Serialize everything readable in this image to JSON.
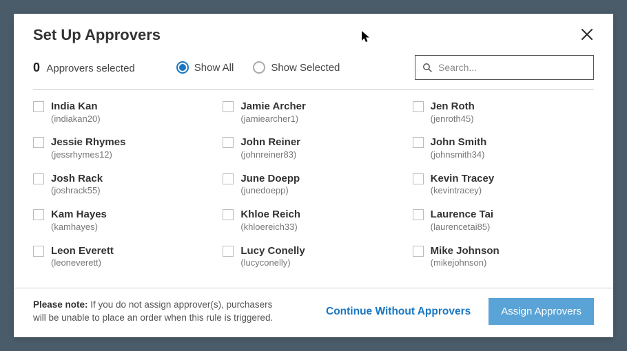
{
  "modal": {
    "title": "Set Up Approvers",
    "selected_count": "0",
    "selected_label": "Approvers selected"
  },
  "filter": {
    "show_all": "Show All",
    "show_selected": "Show Selected",
    "active": "show_all"
  },
  "search": {
    "placeholder": "Search..."
  },
  "approvers": [
    {
      "name": "India Kan",
      "username": "(indiakan20)"
    },
    {
      "name": "Jamie Archer",
      "username": "(jamiearcher1)"
    },
    {
      "name": "Jen Roth",
      "username": "(jenroth45)"
    },
    {
      "name": "Jessie Rhymes",
      "username": "(jessrhymes12)"
    },
    {
      "name": "John Reiner",
      "username": "(johnreiner83)"
    },
    {
      "name": "John Smith",
      "username": "(johnsmith34)"
    },
    {
      "name": "Josh Rack",
      "username": "(joshrack55)"
    },
    {
      "name": "June Doepp",
      "username": "(junedoepp)"
    },
    {
      "name": "Kevin Tracey",
      "username": "(kevintracey)"
    },
    {
      "name": "Kam Hayes",
      "username": "(kamhayes)"
    },
    {
      "name": "Khloe Reich",
      "username": "(khloereich33)"
    },
    {
      "name": "Laurence Tai",
      "username": "(laurencetai85)"
    },
    {
      "name": "Leon Everett",
      "username": "(leoneverett)"
    },
    {
      "name": "Lucy Conelly",
      "username": "(lucyconelly)"
    },
    {
      "name": "Mike Johnson",
      "username": "(mikejohnson)"
    }
  ],
  "footer": {
    "note_label": "Please note:",
    "note_text": " If you do not assign approver(s), purchasers will be unable to place an order when this rule is triggered.",
    "continue_label": "Continue Without Approvers",
    "assign_label": "Assign Approvers"
  }
}
